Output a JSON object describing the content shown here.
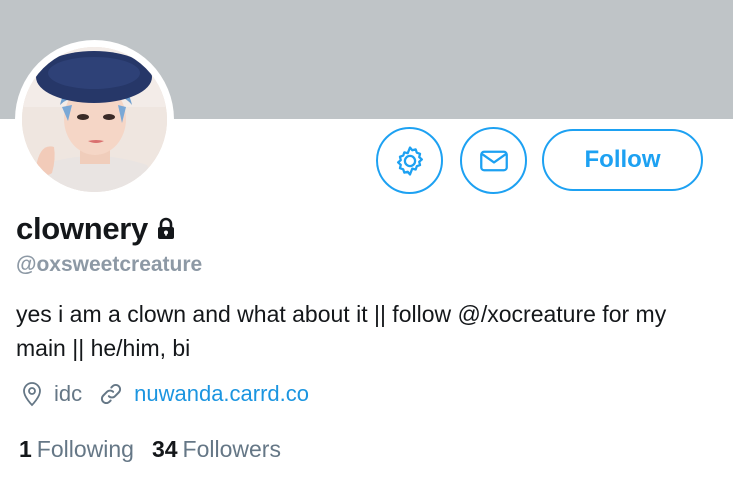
{
  "profile": {
    "display_name": "clownery",
    "handle": "@oxsweetcreature",
    "bio": "yes i am a clown and what about it || follow @/xocreature for my main || he/him, bi",
    "location": "idc",
    "website": "nuwanda.carrd.co",
    "protected": true
  },
  "actions": {
    "follow_label": "Follow",
    "settings_icon": "gear-icon",
    "message_icon": "envelope-icon"
  },
  "stats": {
    "following_count": "1",
    "following_label": "Following",
    "followers_count": "34",
    "followers_label": "Followers"
  },
  "colors": {
    "accent": "#1da1f2",
    "link": "#1b95e0",
    "banner": "#bfc4c7",
    "secondary_text": "#657786"
  }
}
